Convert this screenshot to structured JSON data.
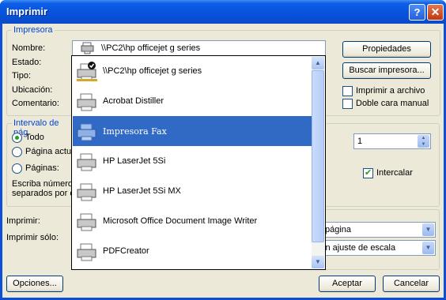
{
  "window": {
    "title": "Imprimir"
  },
  "printer": {
    "legend": "Impresora",
    "name_label": "Nombre:",
    "status_label": "Estado:",
    "type_label": "Tipo:",
    "location_label": "Ubicación:",
    "comment_label": "Comentario:",
    "selected": "\\\\PC2\\hp officejet g series",
    "properties_btn": "Propiedades",
    "find_btn": "Buscar impresora...",
    "print_to_file": "Imprimir a archivo",
    "duplex": "Doble cara manual",
    "print_to_file_checked": false,
    "duplex_checked": false
  },
  "dropdown": {
    "items": [
      {
        "label": "\\\\PC2\\hp officejet g series",
        "icon": "network-default-printer-icon"
      },
      {
        "label": "Acrobat Distiller",
        "icon": "printer-icon"
      },
      {
        "label": "Impresora Fax",
        "icon": "fax-printer-icon"
      },
      {
        "label": "HP LaserJet 5Si",
        "icon": "printer-icon"
      },
      {
        "label": "HP LaserJet 5Si MX",
        "icon": "printer-icon"
      },
      {
        "label": "Microsoft Office Document Image Writer",
        "icon": "printer-icon"
      },
      {
        "label": "PDFCreator",
        "icon": "printer-icon"
      }
    ],
    "selected_index": 2
  },
  "range": {
    "legend": "Intervalo de pág",
    "all": "Todo",
    "current": "Página actu",
    "pages": "Páginas:",
    "hint_line1": "Escriba números",
    "hint_line2": "separados por c",
    "selected": "all"
  },
  "copies": {
    "value": "1",
    "collate": "Intercalar",
    "collate_checked": true
  },
  "print": {
    "what_label": "Imprimir:",
    "only_label": "Imprimir sólo:",
    "pages_per_sheet": "página",
    "scale": "in ajuste de escala"
  },
  "footer": {
    "options": "Opciones...",
    "accept": "Aceptar",
    "cancel": "Cancelar"
  },
  "colors": {
    "accent": "#316ac5",
    "titlebar": "#0a4fd6",
    "face": "#ece9d8",
    "group_text": "#0046d5"
  }
}
